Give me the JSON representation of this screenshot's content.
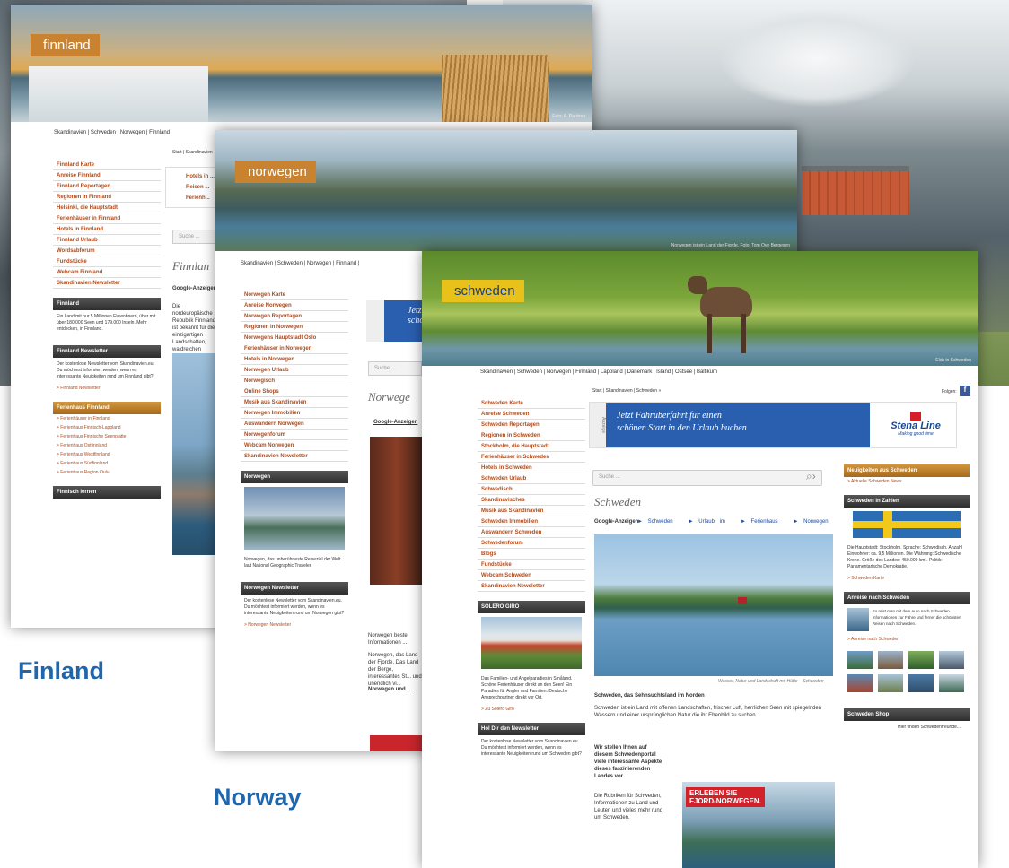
{
  "captions": {
    "finland": "Finland",
    "norway": "Norway"
  },
  "finland": {
    "logo": "finnland",
    "credit": "Foto: A. Paulsen",
    "nav": "Skandinavien | Schweden | Norwegen | Finnland",
    "breadcrumb": "Start | Skandinavien",
    "menu": [
      "Finnland Karte",
      "Anreise Finnland",
      "Finnland Reportagen",
      "Regionen in Finnland",
      "Helsinki, die Hauptstadt",
      "Ferienhäuser in Finnland",
      "Hotels in Finnland",
      "Finnland Urlaub",
      "Wordsabforum",
      "Fundstücke",
      "Webcam Finnland",
      "Skandinavien Newsletter"
    ],
    "box1": {
      "head": "Finnland",
      "text": "Ein Land mit nur 5 Millionen Einwohnern, über mit über 180.000 Seen und 179.000 Inseln. Mehr entdecken, in Finnland."
    },
    "box2": {
      "head": "Finnland Newsletter",
      "text": "Der kostenlose Newsletter vom Skandinavien.eu. Du möchtest informiert werden, wenn es interessante Neuigkeiten rund um Finnland gibt?",
      "link": "> Finnland Newsletter"
    },
    "box3": {
      "head": "Ferienhaus Finnland",
      "links": [
        "> Ferienhäuser in Finnland",
        "> Ferienhaus Finnisch-Lappland",
        "> Ferienhaus Finnische Seenplatte",
        "> Ferienhaus Ostfinnland",
        "> Ferienhaus Westfinnland",
        "> Ferienhaus Südfinnland",
        "> Ferienhaus Region Oulu"
      ]
    },
    "box4": {
      "head": "Finnisch lernen"
    },
    "ad_links": [
      "Hotels in ...",
      "Reisen ...",
      "Ferienh..."
    ],
    "search": "Suche ...",
    "heading": "Finnlan",
    "anz": "Google-Anzeigen",
    "intro": "Die nordeuropäische Republik Finnland ist bekannt für die einzigartigen Landschaften, waldreichen Region ..."
  },
  "norway": {
    "logo": "norwegen",
    "credit": "Norwegen ist ein Land der Fjorde. Foto: Tom Ove Bergesen",
    "nav": "Skandinavien | Schweden | Norwegen | Finnland |",
    "breadcrumb": "Start | Skandinavien",
    "menu": [
      "Norwegen Karte",
      "Anreise Norwegen",
      "Norwegen Reportagen",
      "Regionen in Norwegen",
      "Norwegens Hauptstadt Oslo",
      "Ferienhäuser in Norwegen",
      "Hotels in Norwegen",
      "Norwegen Urlaub",
      "Norwegisch",
      "Online Shops",
      "Musik aus Skandinavien",
      "Norwegen Immobilien",
      "Auswandern Norwegen",
      "Norwegenforum",
      "Webcam Norwegen",
      "Skandinavien Newsletter"
    ],
    "box1": {
      "head": "Norwegen",
      "text": "Norwegen, das unberührteste Reiseziel der Welt laut National Geographic Traveler"
    },
    "box2": {
      "head": "Norwegen Newsletter",
      "text": "Der kostenlose Newsletter vom Skandinavien.eu. Du möchtest informiert werden, wenn es interessante Neuigkeiten rund um Norwegen gibt?",
      "link": "> Norwegen Newsletter"
    },
    "ad": "Jetz schö",
    "search": "Suche ...",
    "heading": "Norwege",
    "anz": "Google-Anzeigen",
    "body1": "Norwegen beste Informationen ...",
    "body2": "Norwegen, das Land der Fjorde. Das Land der Berge, interessantes St... und unendlich vi...",
    "body3": "Norwegen und ..."
  },
  "sweden": {
    "logo": "schweden",
    "credit": "Elch in Schweden",
    "nav": "Skandinavien | Schweden | Norwegen | Finnland | Lappland | Dänemark | Island | Ostsee | Baltikum",
    "breadcrumb": "Start | Skandinavien | Schweden »",
    "follow": "Folgen:",
    "menu": [
      "Schweden Karte",
      "Anreise Schweden",
      "Schweden Reportagen",
      "Regionen in Schweden",
      "Stockholm, die Hauptstadt",
      "Ferienhäuser in Schweden",
      "Hotels in Schweden",
      "Schweden Urlaub",
      "Schwedisch",
      "Skandinavisches",
      "Musik aus Skandinavien",
      "Schweden Immobilien",
      "Auswandern Schweden",
      "Schwedenforum",
      "Blogs",
      "Fundstücke",
      "Webcam Schweden",
      "Skandinavien Newsletter"
    ],
    "box1": {
      "head": "SOLERO GIRO",
      "text": "Das Familien- und Angelparadies in Småland. Schöne Ferienhäuser direkt an den Seen! Ein Paradies für Angler und Familien. Deutsche Ansprechpartner direkt vor Ort.",
      "link": "> Zu Solero Giro"
    },
    "box2": {
      "head": "Hol Dir den Newsletter",
      "text": "Der kostenlose Newsletter vom Skandinavien.eu. Du möchtest informiert werden, wenn es interessante Neuigkeiten rund um Schweden gibt?"
    },
    "ad": {
      "line1": "Jetzt Fährüberfahrt für einen",
      "line2": "schönen Start in den Urlaub buchen",
      "brand": "Stena Line",
      "tag": "Making good time",
      "side": "Anzeige"
    },
    "search": "Suche ...",
    "heading": "Schweden",
    "anz": "Google-Anzeigen",
    "anz_links": [
      "► Schweden",
      "► Urlaub im",
      "► Ferienhaus",
      "► Norwegen"
    ],
    "photo_caption": "Wasser, Natur und Landschaft mit Hütte – Schweden",
    "h2": "Schweden, das Sehnsuchtsland im Norden",
    "p1": "Schweden ist ein Land mit offenen Landschaften, frischer Luft, herrlichen Seen mit spiegelnden Wassern und einer ursprünglichen Natur die ihr Ebenbild zu suchen.",
    "p2": "Wir stellen Ihnen auf diesem Schwedenportal viele interessante Aspekte dieses faszinierenden Landes vor.",
    "p3": "Die Rubriken für Schweden, Informationen zu Land und Leuten und vieles mehr rund um Schweden.",
    "ad2": {
      "line1": "ERLEBEN SIE",
      "line2": "FJORD-NORWEGEN."
    },
    "right": {
      "news_head": "Neuigkeiten aus Schweden",
      "news_link": "> Aktuelle Schweden News",
      "facts_head": "Schweden in Zahlen",
      "facts": "Die Hauptstadt: Stockholm. Sprache: Schwedisch. Anzahl Einwohner: ca. 9,5 Millionen. Die Währung: Schwedische Krone. Größe des Landes: 450.000 km². Politik: Parlamentarische Demokratie.",
      "facts_link": "> Schweden Karte",
      "travel_head": "Anreise nach Schweden",
      "travel_text": "So reist man mit dem Auto nach Schweden. Informationen zur Fähre und ferner die schönsten Reisen nach Schweden.",
      "travel_link": "> Anreise nach Schweden",
      "shop_head": "Schweden Shop",
      "shop_text": "Hier finden Schwedenfreunde..."
    }
  },
  "colors": {
    "caption": "#1f66ad",
    "menu_link": "#b04a1a",
    "orange_logo": "#c9822f",
    "swedish_logo": "#e8c21a",
    "ad_blue": "#2a5fb0"
  }
}
